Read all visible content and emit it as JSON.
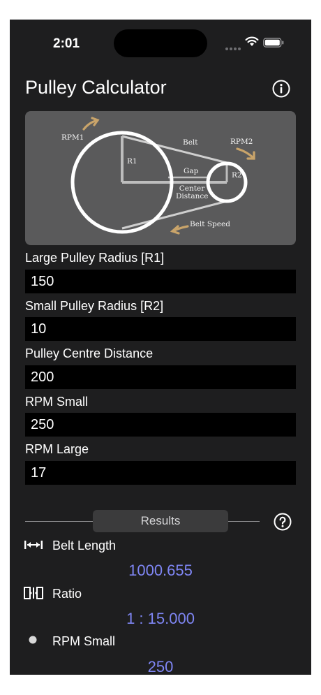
{
  "status_bar": {
    "time": "2:01"
  },
  "nav": {
    "title": "Pulley Calculator",
    "info_icon": "info-circle-icon"
  },
  "diagram": {
    "labels": {
      "rpm1": "RPM1",
      "r1": "R1",
      "belt": "Belt",
      "rpm2": "RPM2",
      "gap": "Gap",
      "r2": "R2",
      "center_line1": "Center",
      "center_line2": "Distance",
      "belt_speed": "Belt Speed"
    },
    "arrow_color": "#c9a46a"
  },
  "form": {
    "fields": [
      {
        "label": "Large Pulley Radius [R1]",
        "value": "150"
      },
      {
        "label": "Small Pulley Radius [R2]",
        "value": "10"
      },
      {
        "label": "Pulley Centre Distance",
        "value": "200"
      },
      {
        "label": "RPM Small",
        "value": "250"
      },
      {
        "label": "RPM Large",
        "value": "17"
      }
    ]
  },
  "results": {
    "header": "Results",
    "help_icon": "question-circle-icon",
    "items": [
      {
        "icon": "length-arrows-icon",
        "label": "Belt Length",
        "value": "1000.655"
      },
      {
        "icon": "ratio-icon",
        "label": "Ratio",
        "value": "1 : 15.000"
      },
      {
        "icon": "dot-icon",
        "label": "RPM Small",
        "value": "250"
      }
    ]
  },
  "colors": {
    "background": "#1e1e1f",
    "result_value": "#7f86f4",
    "diagram_bg": "#5a5a5b"
  }
}
